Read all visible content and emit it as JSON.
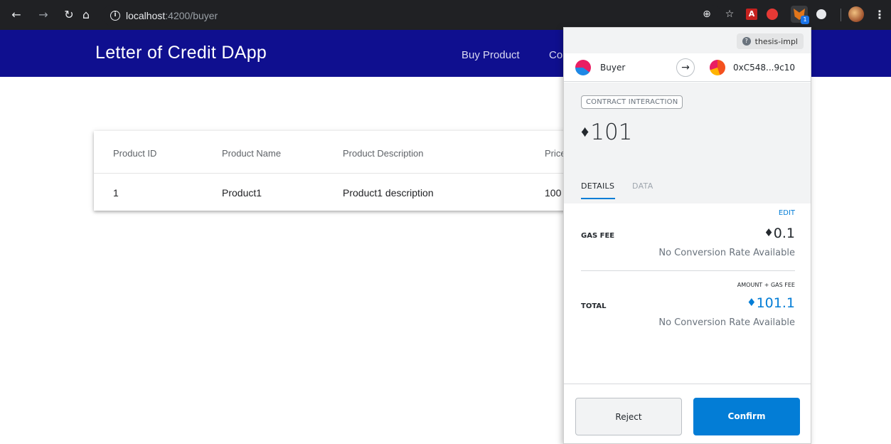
{
  "browser": {
    "url_host": "localhost",
    "url_path": ":4200/buyer",
    "nav_icons": [
      "back-arrow-icon",
      "forward-arrow-icon",
      "reload-icon",
      "home-icon"
    ],
    "extensions": [
      "zoom-icon",
      "star-icon",
      "pdf-extension-icon",
      "red-extension-icon",
      "metamask-fox-icon",
      "white-circle-extension-icon",
      "profile-avatar-icon",
      "menu-dots-icon"
    ],
    "metamask_badge": "1"
  },
  "app": {
    "brand": "Letter of Credit DApp",
    "nav": [
      "Buy Product",
      "Co"
    ]
  },
  "table": {
    "headers": [
      "Product ID",
      "Product Name",
      "Product Description",
      "Price"
    ],
    "rows": [
      [
        "1",
        "Product1",
        "Product1 description",
        "100"
      ]
    ]
  },
  "metamask": {
    "network": "thesis-impl",
    "from_account": "Buyer",
    "to_address": "0xC548...9c10",
    "tag": "CONTRACT INTERACTION",
    "amount": "101",
    "eth_symbol": "♦",
    "tabs": [
      "DETAILS",
      "DATA"
    ],
    "edit_label": "EDIT",
    "gas_fee_label": "GAS FEE",
    "gas_fee_value": "0.1",
    "gas_fee_sub": "No Conversion Rate Available",
    "total_hint": "AMOUNT + GAS FEE",
    "total_label": "TOTAL",
    "total_value": "101.1",
    "total_sub": "No Conversion Rate Available",
    "reject_label": "Reject",
    "confirm_label": "Confirm",
    "accent_color": "#037dd6"
  }
}
